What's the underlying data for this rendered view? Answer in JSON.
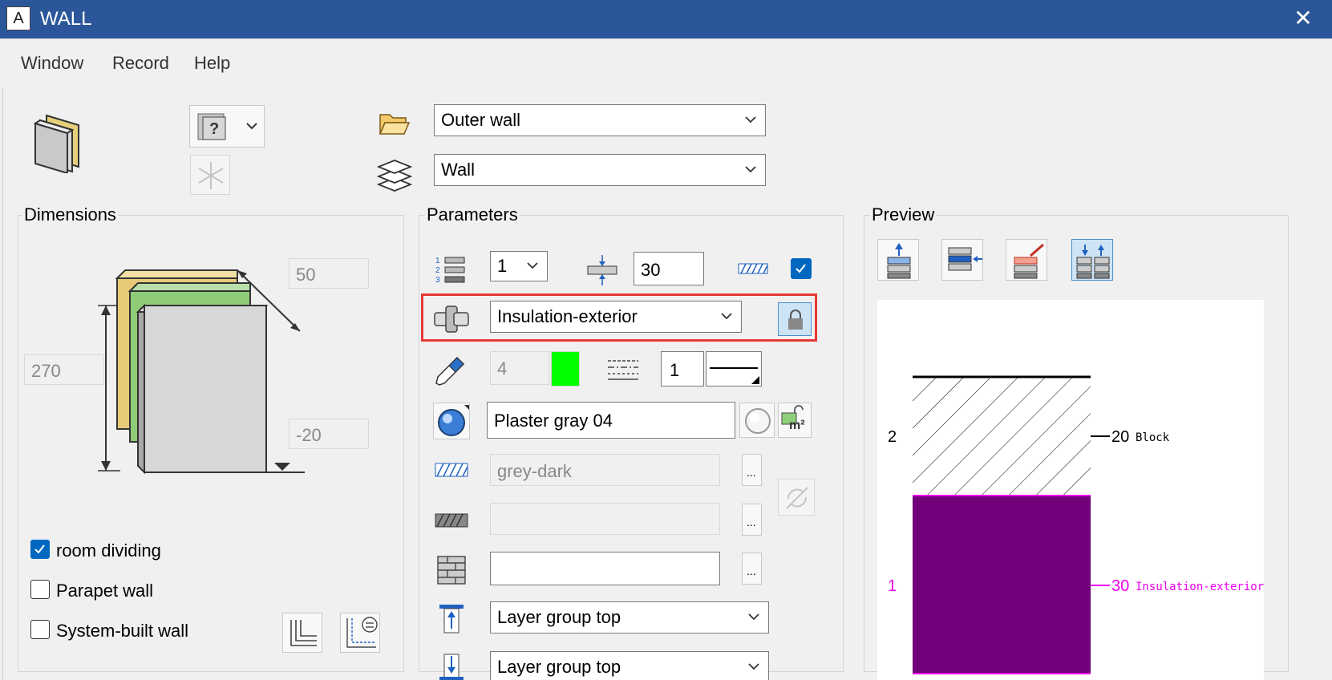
{
  "window": {
    "title": "WALL",
    "app_icon_letter": "A",
    "close_glyph": "✕"
  },
  "menu": [
    "Window",
    "Record",
    "Help"
  ],
  "top": {
    "category_select": "Outer wall",
    "layer_select": "Wall"
  },
  "dimensions": {
    "title": "Dimensions",
    "thickness": "50",
    "height": "270",
    "offset": "-20",
    "checkboxes": [
      {
        "label": "room dividing",
        "checked": true
      },
      {
        "label": "Parapet wall",
        "checked": false
      },
      {
        "label": "System-built wall",
        "checked": false
      }
    ]
  },
  "parameters": {
    "title": "Parameters",
    "layer_count": "1",
    "layer_thickness": "30",
    "hatch_checked": true,
    "material": "Insulation-exterior",
    "pen_value": "4",
    "pen_color": "#00ff00",
    "linetype_value": "1",
    "surface": "Plaster gray 04",
    "hatch_color": "grey-dark",
    "pattern_value": "",
    "brick_value": "",
    "ellipsis": "...",
    "layer_group_top_1": "Layer group top",
    "layer_group_top_2": "Layer group top",
    "m2_label": "m²"
  },
  "preview": {
    "title": "Preview",
    "layers": [
      {
        "index": "2",
        "thickness": "20",
        "name": "Block",
        "color": "#000000"
      },
      {
        "index": "1",
        "thickness": "30",
        "name": "Insulation-exterior",
        "color": "#ee00ee",
        "fill": "#72007a"
      }
    ]
  },
  "colors": {
    "titlebar": "#2b579a",
    "accent": "#0067c0",
    "highlight": "#e53935"
  }
}
